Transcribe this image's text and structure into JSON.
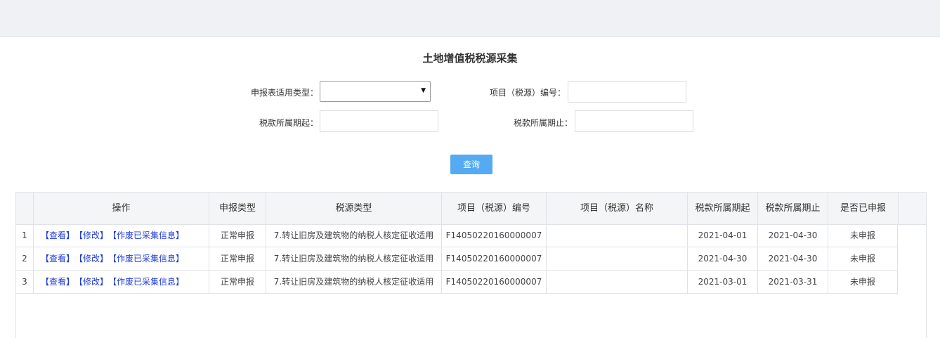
{
  "page": {
    "title": "土地增值税税源采集"
  },
  "form": {
    "table_type_label": "申报表适用类型：",
    "table_type_value": "",
    "project_no_label": "项目（税源）编号：",
    "project_no_value": "",
    "period_start_label": "税款所属期起：",
    "period_start_value": "",
    "period_end_label": "税款所属期止：",
    "period_end_value": ""
  },
  "query_button": "查询",
  "table": {
    "columns": [
      "操作",
      "申报类型",
      "税源类型",
      "项目（税源）编号",
      "项目（税源）名称",
      "税款所属期起",
      "税款所属期止",
      "是否已申报"
    ],
    "rows": [
      {
        "no": "1",
        "actions": [
          "【查看】",
          "【修改】",
          "【作废已采集信息】"
        ],
        "decl_type": "正常申报",
        "source_type": "7.转让旧房及建筑物的纳税人核定征收适用",
        "project_no": "F14050220160000007",
        "project_name": "",
        "start": "2021-04-01",
        "end": "2021-04-30",
        "declared": "未申报"
      },
      {
        "no": "2",
        "actions": [
          "【查看】",
          "【修改】",
          "【作废已采集信息】"
        ],
        "decl_type": "正常申报",
        "source_type": "7.转让旧房及建筑物的纳税人核定征收适用",
        "project_no": "F14050220160000007",
        "project_name": "",
        "start": "2021-04-30",
        "end": "2021-04-30",
        "declared": "未申报"
      },
      {
        "no": "3",
        "actions": [
          "【查看】",
          "【修改】",
          "【作废已采集信息】"
        ],
        "decl_type": "正常申报",
        "source_type": "7.转让旧房及建筑物的纳税人核定征收适用",
        "project_no": "F14050220160000007",
        "project_name": "",
        "start": "2021-03-01",
        "end": "2021-03-31",
        "declared": "未申报"
      }
    ]
  }
}
